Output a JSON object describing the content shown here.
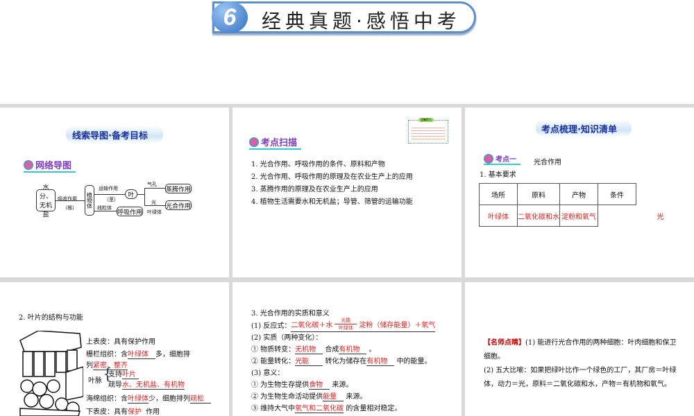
{
  "banner": {
    "number": "6",
    "title": "经典真题·感悟中考"
  },
  "panel1": {
    "title": "线索导图·备考目标",
    "tag": "网络导图",
    "diagram": {
      "source": "水分、无机盐",
      "absorb": "吸收作用",
      "root": "（根）",
      "plant": "植物体",
      "transport": "运输作用",
      "stem": "（茎）",
      "leaf": "叶",
      "mito": "线粒体",
      "respiration": "呼吸作用",
      "stoma": "气孔",
      "transpiration": "蒸腾作用",
      "light": "光",
      "chloroplast": "叶绿体",
      "photosynthesis": "光合作用"
    }
  },
  "panel2": {
    "tag": "考点扫描",
    "note_title": "温馨提示",
    "items": [
      "1. 光合作用、呼吸作用的条件、原料和产物",
      "2. 光合作用、呼吸作用的原理及在农业生产上的应用",
      "3. 蒸腾作用的原理及在农业生产上的应用",
      "4. 植物生活需要水和无机盐；导管、筛管的运输功能"
    ]
  },
  "panel3": {
    "title": "考点梳理·知识清单",
    "tag": "考点一",
    "topic": "光合作用",
    "subtitle": "1. 基本要求",
    "headers": [
      "场所",
      "原料",
      "产物",
      "条件"
    ],
    "answers": [
      "叶绿体",
      "二氧化碳和水",
      "淀粉和氧气",
      "光"
    ]
  },
  "panel4": {
    "heading": "2. 叶片的结构与功能",
    "upper": "上表皮：具有保护作用",
    "palisade_a": "栅栏组织：含",
    "palisade_ans1": "叶绿体",
    "palisade_b": "多，细胞排",
    "palisade_c": "列",
    "palisade_ans2": "紧密、整齐",
    "vein": "叶脉",
    "support": "支持",
    "support_ans": "叶片",
    "conduct": "疏导",
    "conduct_ans": "水、无机盐、有机物",
    "spongy_a": "海绵组织：含",
    "spongy_ans1": "叶绿体",
    "spongy_b": "少，细胞排列",
    "spongy_ans2": "疏松",
    "lower_a": "下表皮：具有",
    "lower_ans": "保护",
    "lower_b": "作用"
  },
  "panel5": {
    "heading": "3. 光合作用的实质和意义",
    "eq_label": "(1) 反应式：",
    "eq_left": "二氧化碳＋水",
    "eq_top": "光能",
    "eq_bottom": "叶绿体",
    "eq_right": "淀粉（储存能量）＋氧气",
    "essence": "(2) 实质（两种变化）：",
    "m1": "① 物质转变：",
    "m1_ans1": "无机物",
    "m1_mid": "合成",
    "m1_ans2": "有机物",
    "m1_end": "。",
    "m2": "② 能量转化：",
    "m2_ans1": "光能",
    "m2_mid": "转化为储存在",
    "m2_ans2": "有机物",
    "m2_end": "中的能量。",
    "meaning": "(3) 意义：",
    "s1": "① 为生物生存提供",
    "s1_ans": "食物",
    "s1_end": "来源。",
    "s2": "② 为生物生命活动提供",
    "s2_ans": "能量",
    "s2_end": "来源。",
    "s3": "③ 维持大气中",
    "s3_ans": "氧气和二氧化碳",
    "s3_end": "的含量相对稳定。"
  },
  "panel6": {
    "label": "【名师点睛】",
    "p1": "(1) 能进行光合作用的两种细胞：叶肉细胞和保卫细胞。",
    "p2": "(2) 五大比喻：如果把绿叶比作一个绿色的工厂，其厂房＝叶绿体，动力＝光，原料＝二氧化碳和水，产物＝有机物和氧气。"
  }
}
